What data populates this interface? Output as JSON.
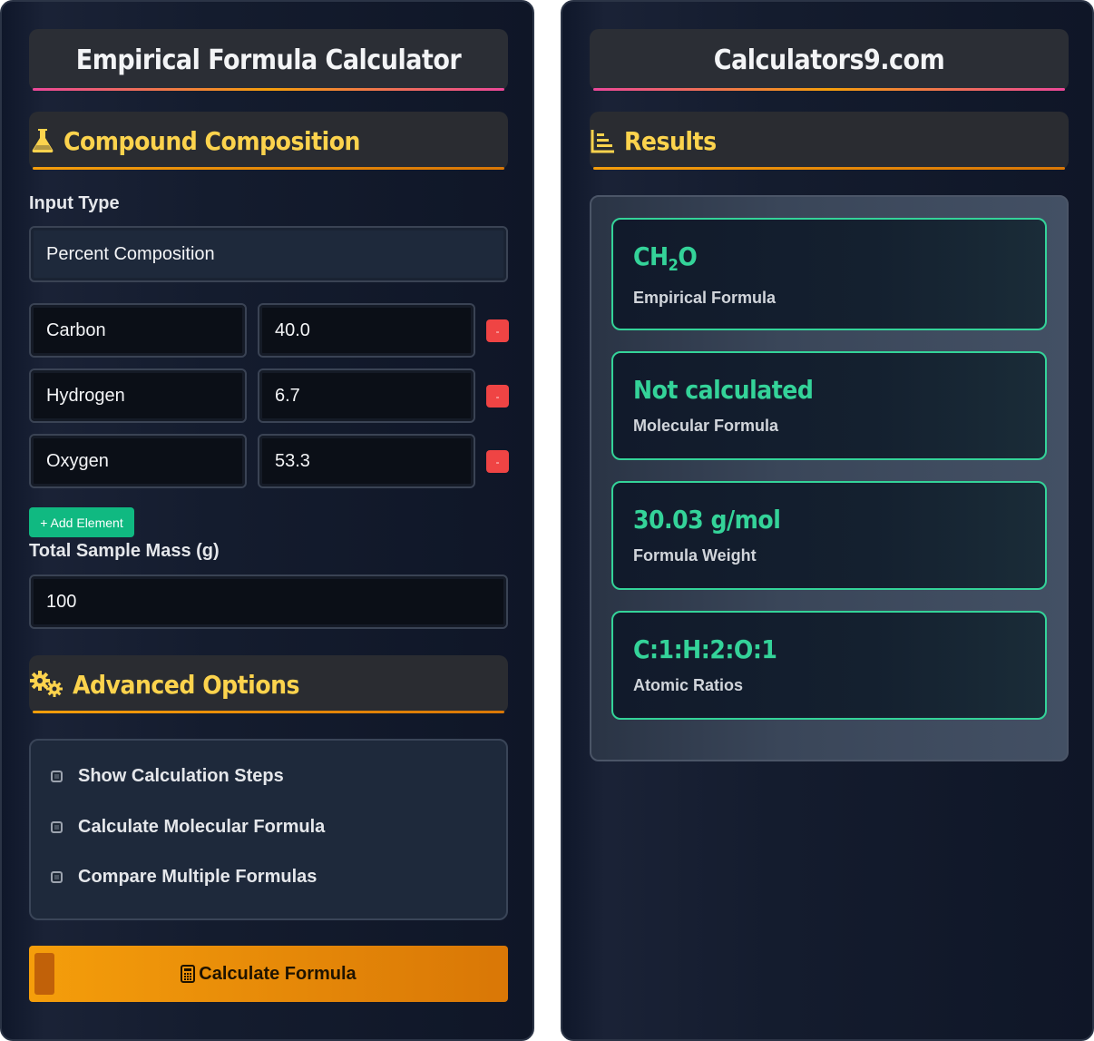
{
  "left_panel": {
    "title": "Empirical Formula Calculator",
    "composition_heading": "Compound Composition",
    "input_type_label": "Input Type",
    "input_type_value": "Percent Composition",
    "elements": [
      {
        "name": "Carbon",
        "value": "40.0",
        "remove_label": "-"
      },
      {
        "name": "Hydrogen",
        "value": "6.7",
        "remove_label": "-"
      },
      {
        "name": "Oxygen",
        "value": "53.3",
        "remove_label": "-"
      }
    ],
    "add_element_label": "+ Add Element",
    "sample_mass_label": "Total Sample Mass (g)",
    "sample_mass_value": "100",
    "advanced_heading": "Advanced Options",
    "options": [
      {
        "label": "Show Calculation Steps",
        "checked": false
      },
      {
        "label": "Calculate Molecular Formula",
        "checked": false
      },
      {
        "label": "Compare Multiple Formulas",
        "checked": false
      }
    ],
    "calculate_label": "Calculate Formula"
  },
  "right_panel": {
    "title": "Calculators9.com",
    "results_heading": "Results",
    "empirical_formula": {
      "prefix": "CH",
      "subscript": "2",
      "suffix": "O",
      "label": "Empirical Formula"
    },
    "molecular_formula": {
      "value": "Not calculated",
      "label": "Molecular Formula"
    },
    "formula_weight": {
      "value": "30.03 g/mol",
      "label": "Formula Weight"
    },
    "atomic_ratios": {
      "value": "C:1:H:2:O:1",
      "label": "Atomic Ratios"
    }
  },
  "colors": {
    "accent_yellow": "#fcd34d",
    "accent_green": "#34d399",
    "danger_red": "#ef4444",
    "button_orange": "#f59e0b",
    "add_green": "#10b981"
  },
  "icons": [
    "flask-icon",
    "chart-icon",
    "gears-icon",
    "calculator-icon"
  ]
}
